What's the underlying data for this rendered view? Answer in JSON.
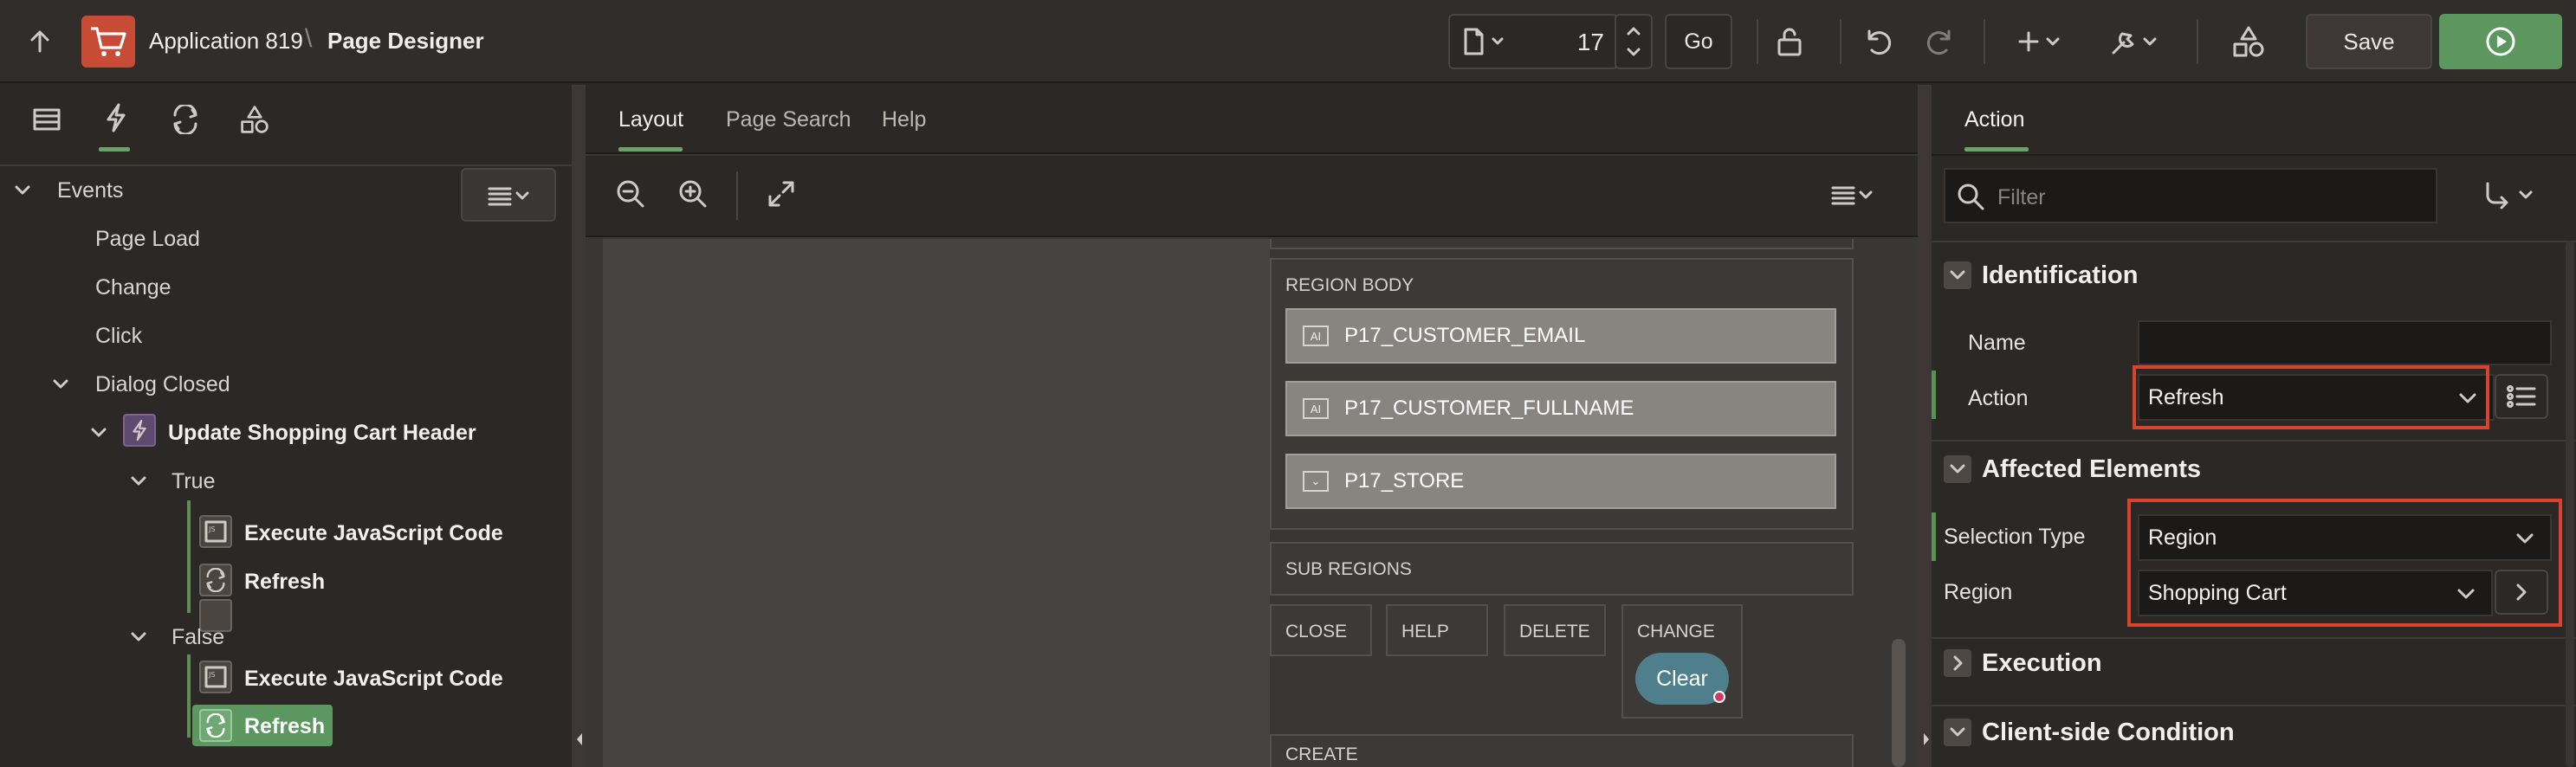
{
  "header": {
    "app_name": "Application 819",
    "separator": "\\",
    "page_title": "Page Designer",
    "page_number": "17",
    "go_label": "Go",
    "save_label": "Save"
  },
  "left_panel": {
    "events_label": "Events",
    "items": {
      "page_load": "Page Load",
      "change": "Change",
      "click": "Click",
      "dialog_closed": "Dialog Closed",
      "da_name": "Update Shopping Cart Header",
      "true_label": "True",
      "true_action1": "Execute JavaScript Code",
      "true_action2": "Refresh",
      "false_label": "False",
      "false_action1": "Execute JavaScript Code",
      "false_action2": "Refresh"
    }
  },
  "center": {
    "tabs": [
      "Layout",
      "Page Search",
      "Help"
    ],
    "region_body": "REGION BODY",
    "items": [
      "P17_CUSTOMER_EMAIL",
      "P17_CUSTOMER_FULLNAME",
      "P17_STORE"
    ],
    "sub_regions": "SUB REGIONS",
    "buttons": [
      "CLOSE",
      "HELP",
      "DELETE",
      "CHANGE"
    ],
    "clear_label": "Clear",
    "create": "CREATE"
  },
  "right": {
    "tab": "Action",
    "filter_placeholder": "Filter",
    "identification": "Identification",
    "name_label": "Name",
    "name_value": "",
    "action_label": "Action",
    "action_value": "Refresh",
    "affected_elements": "Affected Elements",
    "selection_type_label": "Selection Type",
    "selection_type_value": "Region",
    "region_label": "Region",
    "region_value": "Shopping Cart",
    "execution": "Execution",
    "client_condition": "Client-side Condition"
  },
  "colors": {
    "accent_green": "#5d9760",
    "highlight_red": "#d9432c",
    "app_icon_bg": "#c84b36"
  }
}
